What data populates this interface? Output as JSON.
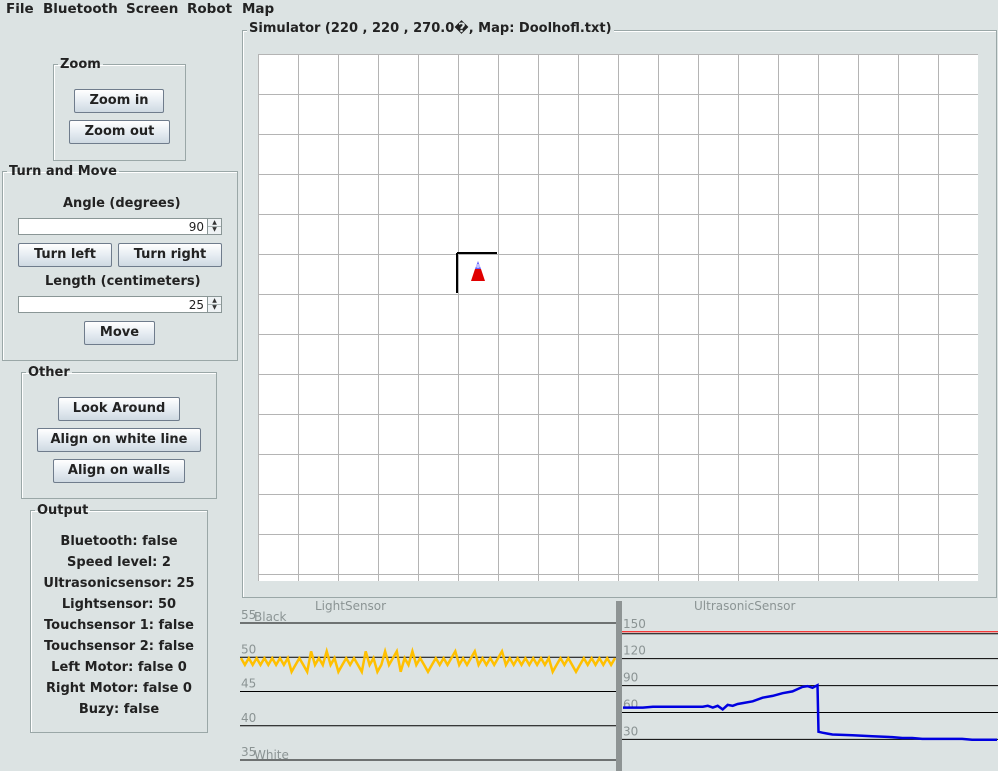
{
  "menu": [
    "File",
    "Bluetooth",
    "Screen",
    "Robot",
    "Map"
  ],
  "zoom": {
    "legend": "Zoom",
    "zoom_in": "Zoom in",
    "zoom_out": "Zoom out"
  },
  "turn_move": {
    "legend": "Turn and Move",
    "angle_label": "Angle (degrees)",
    "angle_value": "90",
    "turn_left": "Turn left",
    "turn_right": "Turn right",
    "length_label": "Length (centimeters)",
    "length_value": "25",
    "move": "Move"
  },
  "other": {
    "legend": "Other",
    "look_around": "Look Around",
    "align_white_line": "Align on white line",
    "align_walls": "Align on walls"
  },
  "output": {
    "legend": "Output",
    "lines": [
      "Bluetooth: false",
      "Speed level: 2",
      "Ultrasonicsensor: 25",
      "Lightsensor: 50",
      "Touchsensor 1: false",
      "Touchsensor 2: false",
      "Left Motor: false 0",
      "Right Motor: false 0",
      "Buzy: false"
    ]
  },
  "simulator": {
    "title": "Simulator (220 , 220 , 270.0�, Map: Doolhofl.txt)",
    "robot_icon": "robot-icon",
    "wall_color": "#000000",
    "grid_color": "#b4b4b4"
  },
  "chart_data": [
    {
      "type": "line",
      "title": "LightSensor",
      "ylim": [
        35,
        55
      ],
      "yticks": [
        55,
        50,
        45,
        40,
        35
      ],
      "annotations": [
        "Black",
        "White"
      ],
      "series_color": "#ffc000",
      "values": [
        49,
        48,
        49,
        48,
        49,
        48,
        49,
        48,
        49,
        48,
        49,
        48,
        49,
        47,
        48,
        49,
        48,
        47,
        50,
        48,
        49,
        48,
        50,
        48,
        49,
        47,
        48,
        49,
        48,
        49,
        48,
        47,
        50,
        48,
        49,
        47,
        48,
        50,
        48,
        49,
        50,
        47,
        49,
        48,
        50,
        48,
        49,
        48,
        47,
        48,
        49,
        48,
        49,
        48,
        49,
        50,
        48,
        49,
        48,
        49,
        50,
        48,
        49,
        48,
        49,
        48,
        49,
        50,
        48,
        49,
        48,
        49,
        48,
        49,
        48,
        49,
        48,
        49,
        48,
        49,
        47,
        48,
        49,
        48,
        49,
        48,
        47,
        48,
        49,
        48,
        49,
        48,
        49,
        48,
        49,
        48,
        49
      ]
    },
    {
      "type": "line",
      "title": "UltrasonicSensor",
      "ylim": [
        17,
        152
      ],
      "yticks": [
        150,
        120,
        90,
        60,
        30
      ],
      "series_color": "#0000e0",
      "threshold_color": "#ff0000",
      "x": [
        0,
        10,
        20,
        30,
        40,
        50,
        60,
        70,
        80,
        85,
        90,
        95,
        100,
        105,
        110,
        115,
        120,
        130,
        140,
        150,
        160,
        170,
        180,
        185,
        190,
        195,
        196,
        200,
        205,
        210,
        230,
        250,
        270,
        280,
        290,
        300,
        310,
        330,
        340,
        350,
        360,
        375
      ],
      "values": [
        61,
        61,
        61,
        62,
        62,
        62,
        62,
        62,
        62,
        63,
        61,
        63,
        59,
        64,
        63,
        65,
        66,
        68,
        72,
        74,
        77,
        79,
        84,
        85,
        83,
        86,
        34,
        33,
        32,
        31,
        30,
        29,
        28,
        27,
        27,
        26,
        26,
        26,
        26,
        25,
        25,
        25
      ]
    }
  ]
}
